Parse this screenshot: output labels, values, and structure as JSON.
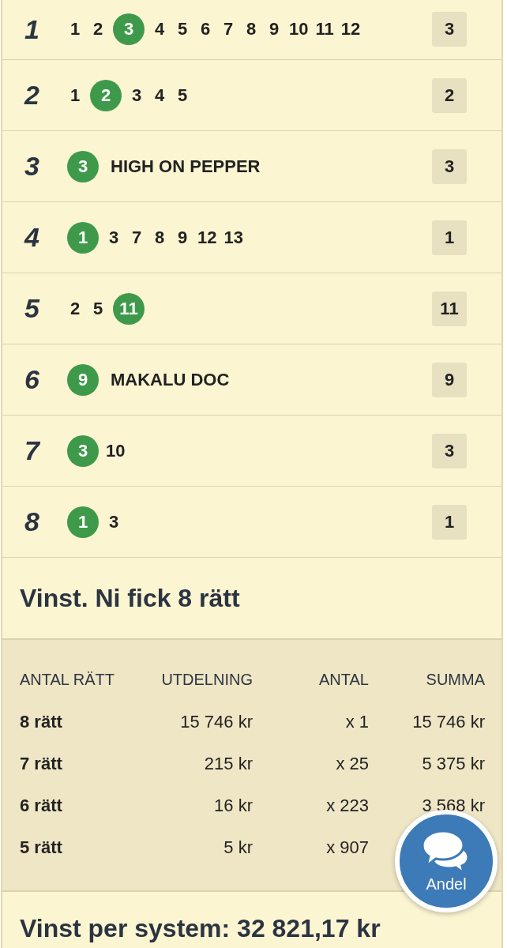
{
  "legs": [
    {
      "number": "1",
      "result": "3",
      "picks": [
        {
          "label": "1",
          "selected": false
        },
        {
          "label": "2",
          "selected": false
        },
        {
          "label": "3",
          "selected": true
        },
        {
          "label": "4",
          "selected": false
        },
        {
          "label": "5",
          "selected": false
        },
        {
          "label": "6",
          "selected": false
        },
        {
          "label": "7",
          "selected": false
        },
        {
          "label": "8",
          "selected": false
        },
        {
          "label": "9",
          "selected": false
        },
        {
          "label": "10",
          "selected": false
        },
        {
          "label": "11",
          "selected": false
        },
        {
          "label": "12",
          "selected": false
        }
      ]
    },
    {
      "number": "2",
      "result": "2",
      "picks": [
        {
          "label": "1",
          "selected": false
        },
        {
          "label": "2",
          "selected": true
        },
        {
          "label": "3",
          "selected": false
        },
        {
          "label": "4",
          "selected": false
        },
        {
          "label": "5",
          "selected": false
        }
      ]
    },
    {
      "number": "3",
      "result": "3",
      "picks": [
        {
          "label": "3",
          "selected": true
        }
      ],
      "horse": "HIGH ON PEPPER"
    },
    {
      "number": "4",
      "result": "1",
      "picks": [
        {
          "label": "1",
          "selected": true
        },
        {
          "label": "3",
          "selected": false
        },
        {
          "label": "7",
          "selected": false
        },
        {
          "label": "8",
          "selected": false
        },
        {
          "label": "9",
          "selected": false
        },
        {
          "label": "12",
          "selected": false
        },
        {
          "label": "13",
          "selected": false
        }
      ]
    },
    {
      "number": "5",
      "result": "11",
      "picks": [
        {
          "label": "2",
          "selected": false
        },
        {
          "label": "5",
          "selected": false
        },
        {
          "label": "11",
          "selected": true
        }
      ]
    },
    {
      "number": "6",
      "result": "9",
      "picks": [
        {
          "label": "9",
          "selected": true
        }
      ],
      "horse": "MAKALU DOC"
    },
    {
      "number": "7",
      "result": "3",
      "picks": [
        {
          "label": "3",
          "selected": true
        },
        {
          "label": "10",
          "selected": false
        }
      ]
    },
    {
      "number": "8",
      "result": "1",
      "picks": [
        {
          "label": "1",
          "selected": true
        },
        {
          "label": "3",
          "selected": false
        }
      ]
    }
  ],
  "win_heading": "Vinst. Ni fick 8 rätt",
  "payout_table": {
    "columns": [
      "ANTAL RÄTT",
      "UTDELNING",
      "ANTAL",
      "SUMMA"
    ],
    "rows": [
      [
        "8 rätt",
        "15 746 kr",
        "x 1",
        "15 746 kr"
      ],
      [
        "7 rätt",
        "215 kr",
        "x 25",
        "5 375 kr"
      ],
      [
        "6 rätt",
        "16 kr",
        "x 223",
        "3 568 kr"
      ],
      [
        "5 rätt",
        "5 kr",
        "x 907"
      ]
    ]
  },
  "system_total": "Vinst per system: 32 821,17 kr",
  "chat_button": {
    "label": "Andel"
  }
}
